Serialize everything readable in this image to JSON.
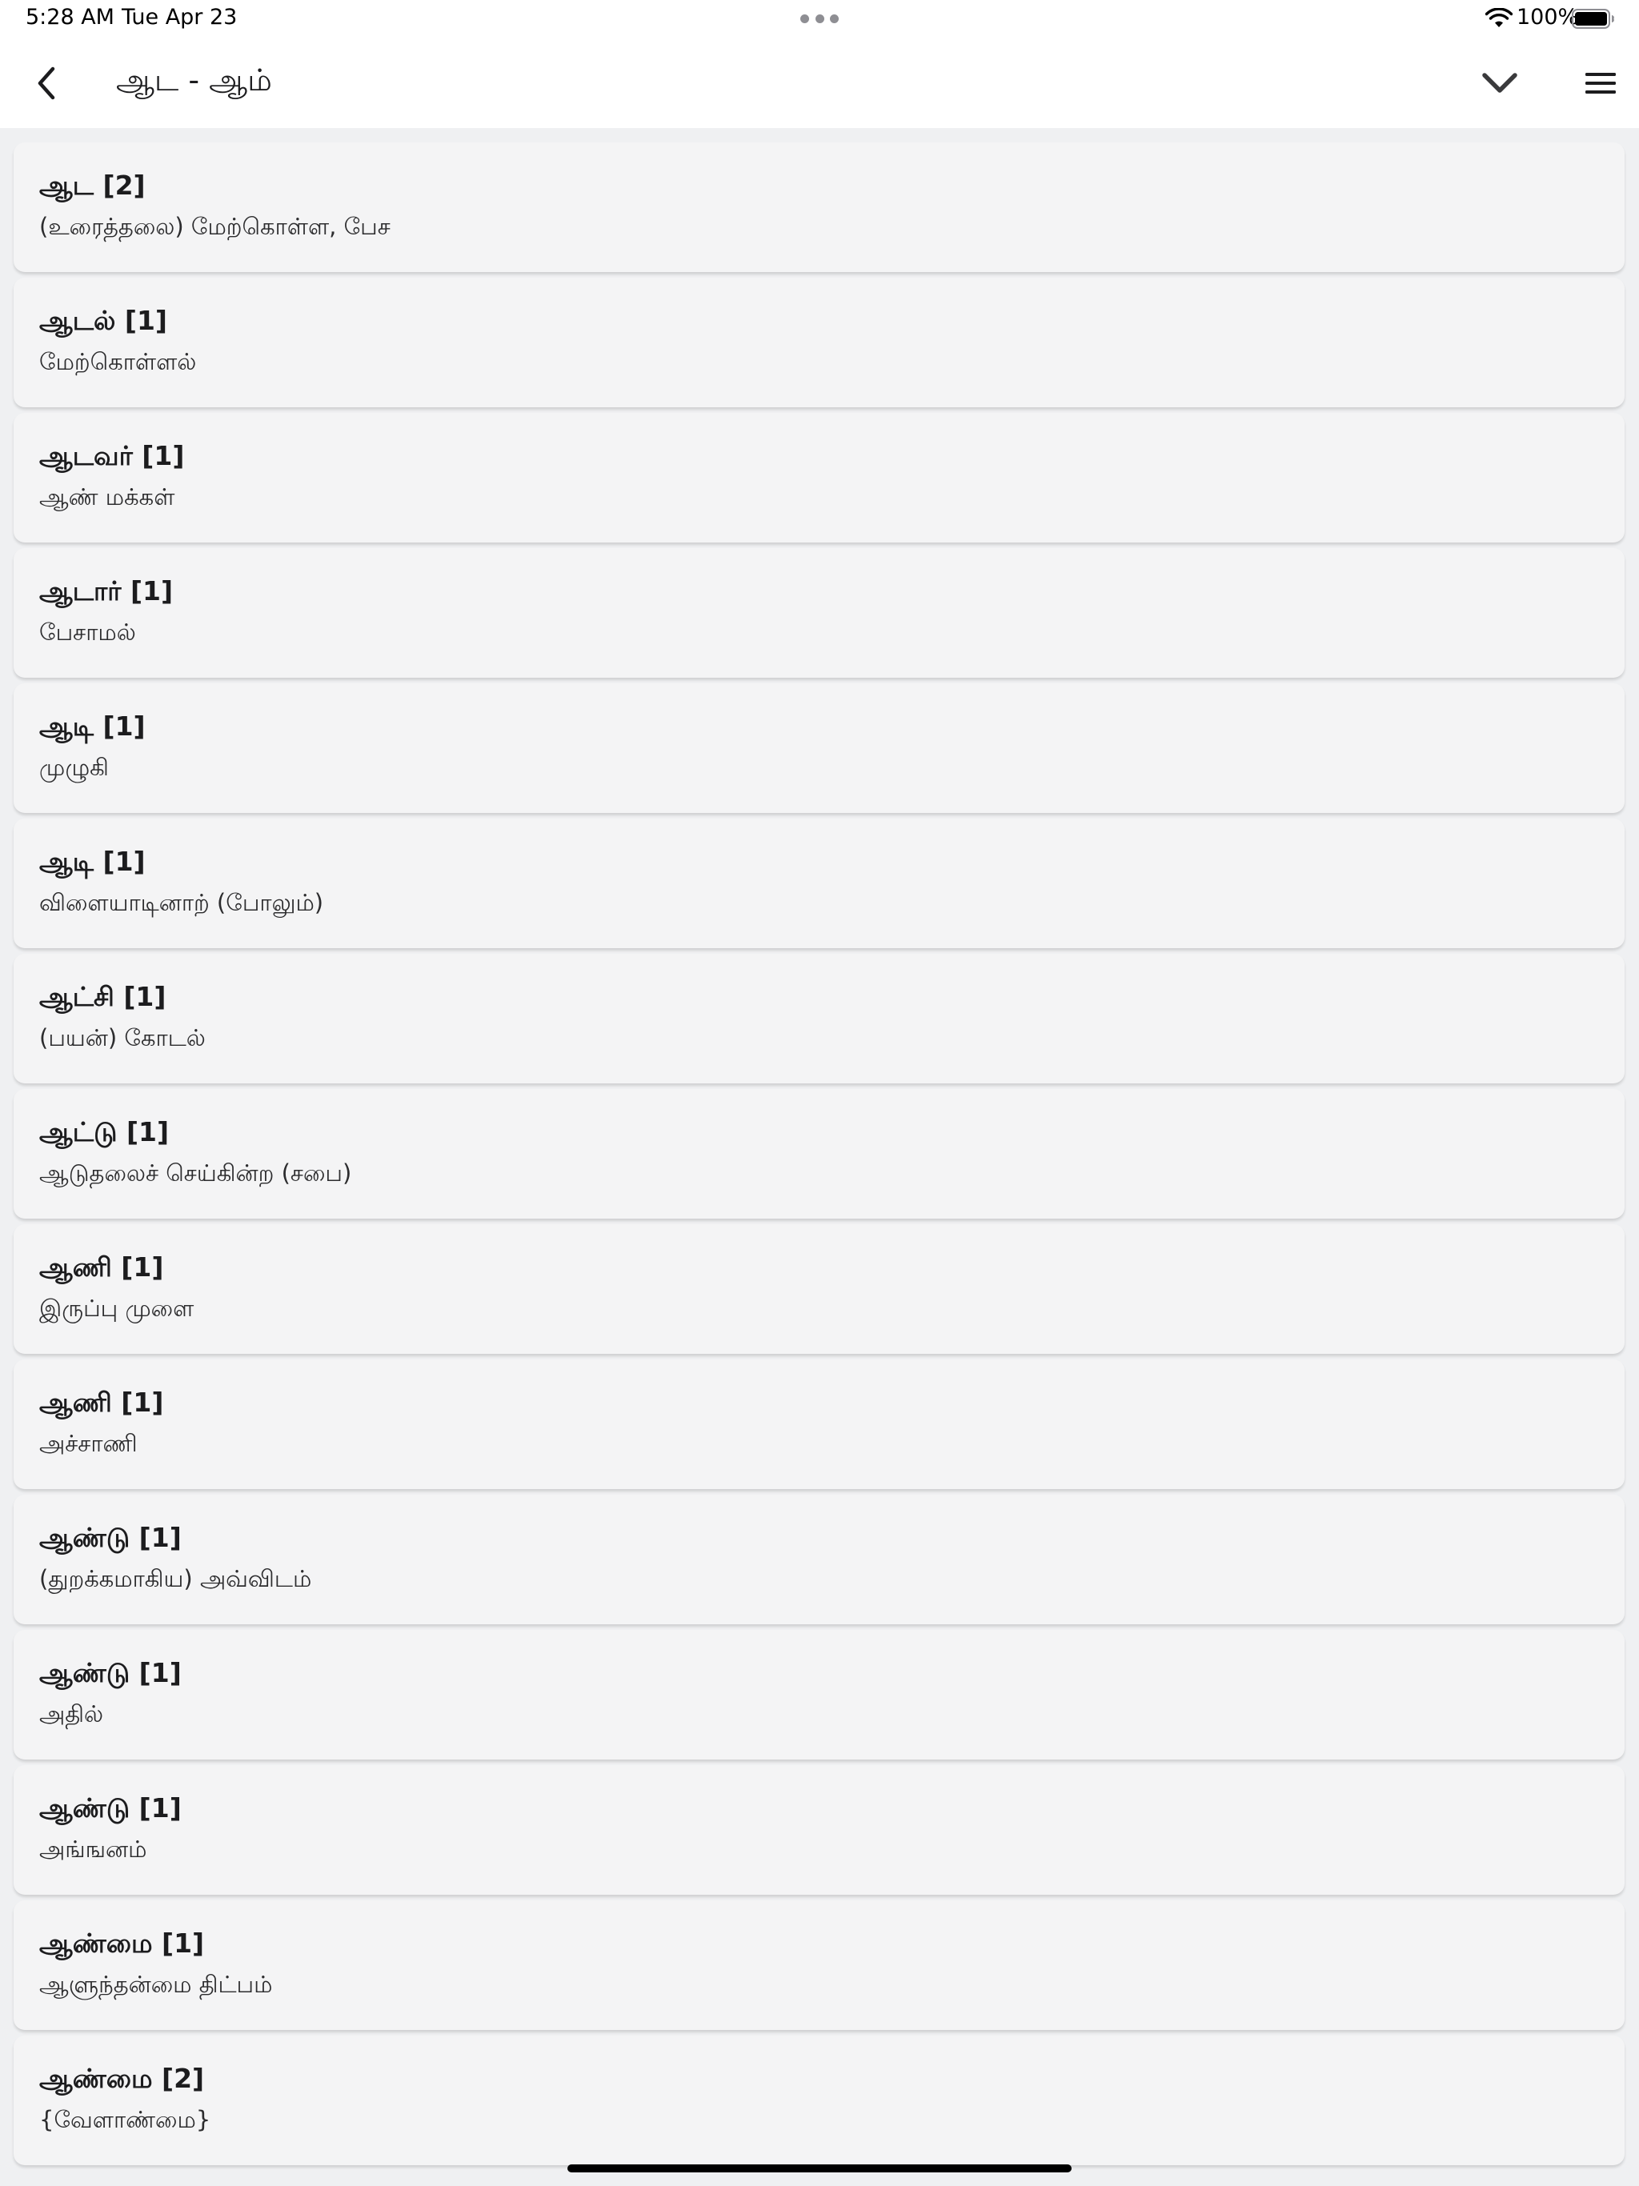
{
  "status_bar": {
    "time": "5:28 AM",
    "date": "Tue Apr 23",
    "battery": "100%"
  },
  "header": {
    "title": "ஆட - ஆம்",
    "icons": [
      "chevron-left-icon",
      "chevron-down-icon",
      "hamburger-menu-icon"
    ]
  },
  "entries": [
    {
      "head": "ஆட [2]",
      "sub": "(உரைத்தலை) மேற்கொள்ள, பேச"
    },
    {
      "head": "ஆடல் [1]",
      "sub": "மேற்கொள்ளல்"
    },
    {
      "head": "ஆடவர் [1]",
      "sub": "ஆண் மக்கள்"
    },
    {
      "head": "ஆடார் [1]",
      "sub": "பேசாமல்"
    },
    {
      "head": "ஆடி [1]",
      "sub": "முழுகி"
    },
    {
      "head": "ஆடி [1]",
      "sub": "விளையாடினாற் (போலும்)"
    },
    {
      "head": "ஆட்சி [1]",
      "sub": "(பயன்) கோடல்"
    },
    {
      "head": "ஆட்டு [1]",
      "sub": "ஆடுதலைச் செய்கின்ற (சபை)"
    },
    {
      "head": "ஆணி [1]",
      "sub": "இருப்பு முளை"
    },
    {
      "head": "ஆணி [1]",
      "sub": "அச்சாணி"
    },
    {
      "head": "ஆண்டு [1]",
      "sub": "(துறக்கமாகிய) அவ்விடம்"
    },
    {
      "head": "ஆண்டு [1]",
      "sub": "அதில்"
    },
    {
      "head": "ஆண்டு [1]",
      "sub": "அங்ஙனம்"
    },
    {
      "head": "ஆண்மை [1]",
      "sub": "ஆளுந்தன்மை திட்பம்"
    },
    {
      "head": "ஆண்மை [2]",
      "sub": "{வேளாண்மை}"
    }
  ]
}
